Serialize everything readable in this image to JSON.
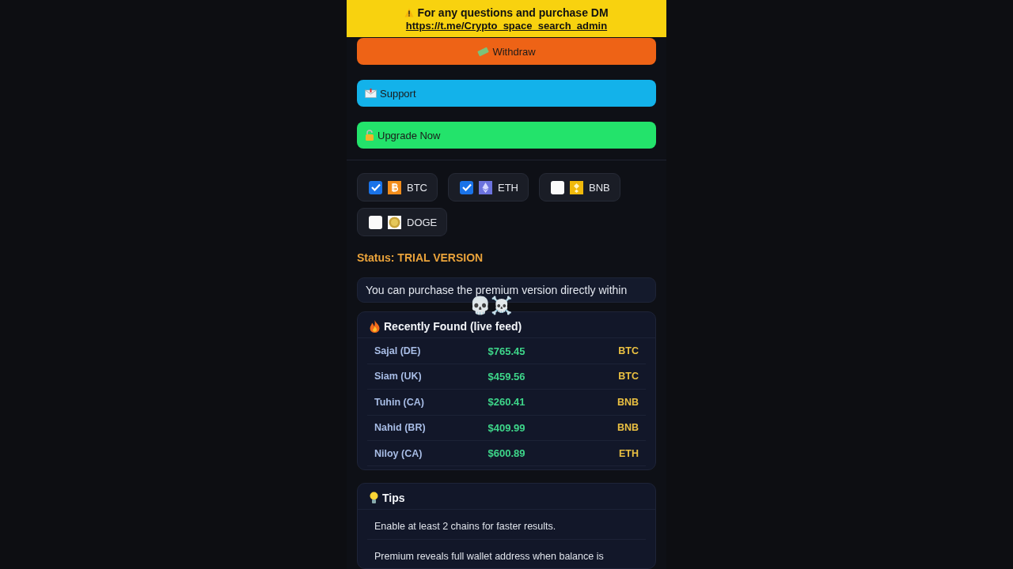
{
  "banner": {
    "text": "For any questions and purchase DM",
    "link": "https://t.me/Crypto_space_search_admin"
  },
  "actions": [
    {
      "kind": "withdraw",
      "label": "Withdraw"
    },
    {
      "kind": "support",
      "label": "Support"
    },
    {
      "kind": "upgrade",
      "label": "Upgrade Now"
    }
  ],
  "chains": [
    {
      "symbol": "BTC",
      "checked": true
    },
    {
      "symbol": "ETH",
      "checked": true
    },
    {
      "symbol": "BNB",
      "checked": false
    },
    {
      "symbol": "DOGE",
      "checked": false
    }
  ],
  "status": "Status: TRIAL VERSION",
  "marquee": "You can purchase the premium version directly within",
  "sticker": "💀☠️",
  "feed": {
    "title": "Recently Found (live feed)",
    "rows": [
      {
        "name": "Sajal (DE)",
        "amount": "$765.45",
        "coin": "BTC"
      },
      {
        "name": "Siam (UK)",
        "amount": "$459.56",
        "coin": "BTC"
      },
      {
        "name": "Tuhin (CA)",
        "amount": "$260.41",
        "coin": "BNB"
      },
      {
        "name": "Nahid (BR)",
        "amount": "$409.99",
        "coin": "BNB"
      },
      {
        "name": "Niloy (CA)",
        "amount": "$600.89",
        "coin": "ETH"
      }
    ]
  },
  "tips": {
    "title": "Tips",
    "items": [
      "Enable at least 2 chains for faster results.",
      "Premium reveals full wallet address when balance is"
    ]
  }
}
